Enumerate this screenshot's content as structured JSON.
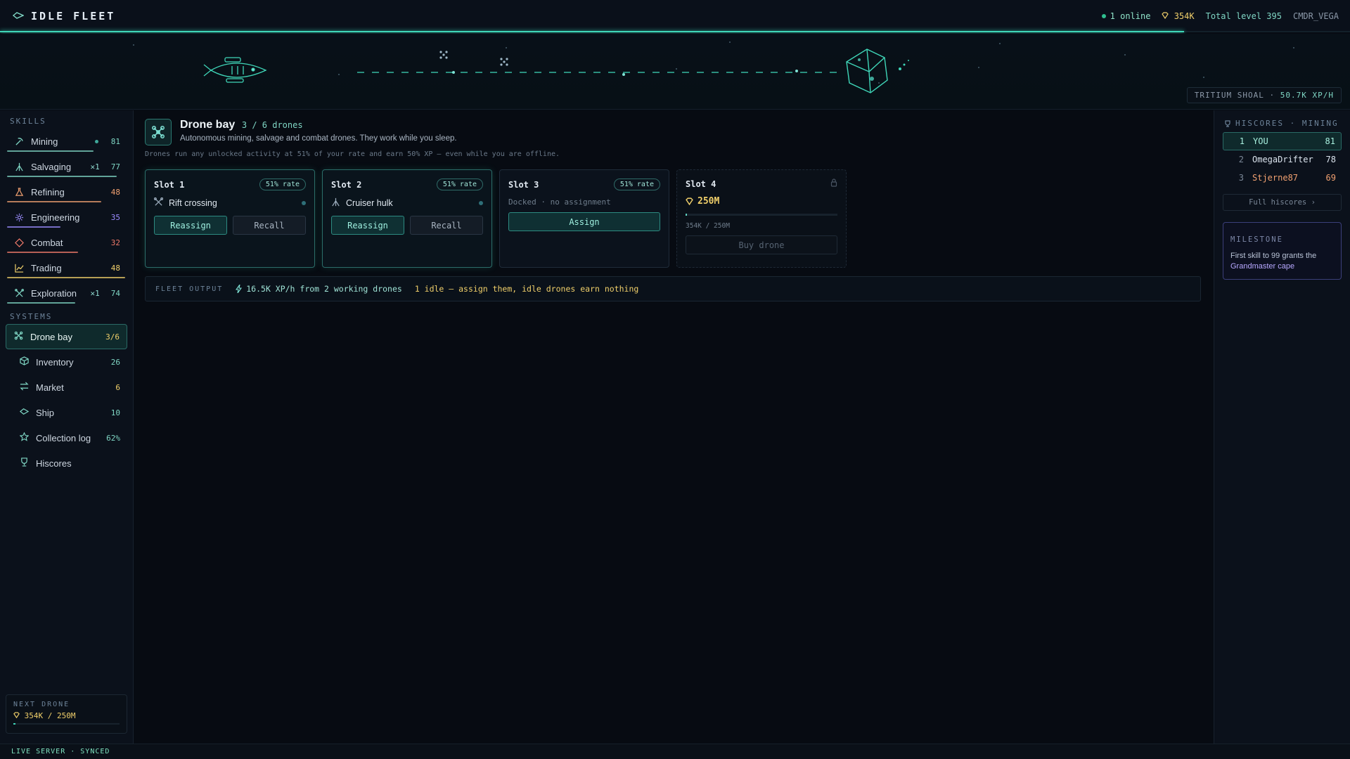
{
  "app": {
    "title": "IDLE FLEET",
    "online": "1 online",
    "credits": "354K",
    "total_level": "Total level 395",
    "username": "CMDR_VEGA",
    "xp_progress_fraction": 0.877
  },
  "scene": {
    "zone_name": "TRITIUM SHOAL",
    "zone_separator": "·",
    "zone_rate": "50.7K XP/H"
  },
  "sidebar": {
    "skills_title": "SKILLS",
    "skills": [
      {
        "name": "Mining",
        "level": "81",
        "icon": "pickaxe-icon",
        "color": "#7fd6c4",
        "progress": 0.73,
        "active_dot": true,
        "drone_tag": ""
      },
      {
        "name": "Salvaging",
        "level": "77",
        "icon": "salvage-icon",
        "color": "#7fd6c4",
        "progress": 0.93,
        "active_dot": false,
        "drone_tag": "1"
      },
      {
        "name": "Refining",
        "level": "48",
        "icon": "flask-icon",
        "color": "#f0a070",
        "progress": 0.8,
        "active_dot": false,
        "drone_tag": ""
      },
      {
        "name": "Engineering",
        "level": "35",
        "icon": "gear-icon",
        "color": "#9b8cff",
        "progress": 0.45,
        "active_dot": false,
        "drone_tag": ""
      },
      {
        "name": "Combat",
        "level": "32",
        "icon": "crosshair-icon",
        "color": "#f07a6a",
        "progress": 0.6,
        "active_dot": false,
        "drone_tag": ""
      },
      {
        "name": "Trading",
        "level": "48",
        "icon": "chart-icon",
        "color": "#f0cf6a",
        "progress": 1.0,
        "active_dot": false,
        "drone_tag": ""
      },
      {
        "name": "Exploration",
        "level": "74",
        "icon": "compass-icon",
        "color": "#7fd6c4",
        "progress": 0.58,
        "active_dot": false,
        "drone_tag": "1"
      }
    ],
    "systems_title": "SYSTEMS",
    "systems": [
      {
        "name": "Drone bay",
        "count": "3/6",
        "icon": "drone-icon",
        "count_color": "#f0cf6a",
        "active": true
      },
      {
        "name": "Inventory",
        "count": "26",
        "icon": "cube-icon",
        "count_color": "#7fd6c4",
        "active": false
      },
      {
        "name": "Market",
        "count": "6",
        "icon": "swap-icon",
        "count_color": "#f0cf6a",
        "active": false
      },
      {
        "name": "Ship",
        "count": "10",
        "icon": "ship-icon",
        "count_color": "#7fd6c4",
        "active": false
      },
      {
        "name": "Collection log",
        "count": "62%",
        "icon": "star-icon",
        "count_color": "#7fd6c4",
        "active": false
      },
      {
        "name": "Hiscores",
        "count": "",
        "icon": "trophy-icon",
        "count_color": "#7fd6c4",
        "active": false
      }
    ],
    "next_drone": {
      "title": "NEXT DRONE",
      "value": "354K / 250M",
      "progress": 0.0014
    }
  },
  "main": {
    "title": "Drone bay",
    "count": "3 / 6 drones",
    "description": "Autonomous mining, salvage and combat drones. They work while you sleep.",
    "note": "Drones run any unlocked activity at 51% of your rate and earn 50% XP — even while you are offline.",
    "slots": [
      {
        "name": "Slot 1",
        "rate": "51% rate",
        "activity": "Rift crossing",
        "activity_icon": "crossing-icon",
        "primary": "Reassign",
        "secondary": "Recall"
      },
      {
        "name": "Slot 2",
        "rate": "51% rate",
        "activity": "Cruiser hulk",
        "activity_icon": "salvage-icon",
        "primary": "Reassign",
        "secondary": "Recall"
      },
      {
        "name": "Slot 3",
        "rate": "51% rate",
        "status": "Docked · no assignment",
        "primary": "Assign"
      },
      {
        "name": "Slot 4",
        "price": "250M",
        "price_progress": "354K / 250M",
        "progress": 0.0014,
        "button": "Buy drone"
      }
    ],
    "output": {
      "label": "FLEET OUTPUT",
      "rate": "16.5K XP/h from 2 working drones",
      "warning": "1 idle — assign them, idle drones earn nothing"
    }
  },
  "hiscores": {
    "title": "HISCORES · MINING",
    "rows": [
      {
        "rank": "1",
        "name": "YOU",
        "level": "81",
        "me": true
      },
      {
        "rank": "2",
        "name": "OmegaDrifter",
        "level": "78",
        "me": false
      },
      {
        "rank": "3",
        "name": "Stjerne87",
        "level": "69",
        "me": false
      }
    ],
    "full_button": "Full hiscores ›"
  },
  "milestone": {
    "title": "MILESTONE",
    "text": "First skill to 99 grants the",
    "highlight": "Grandmaster cape"
  },
  "footer": {
    "status": "LIVE SERVER · SYNCED"
  }
}
